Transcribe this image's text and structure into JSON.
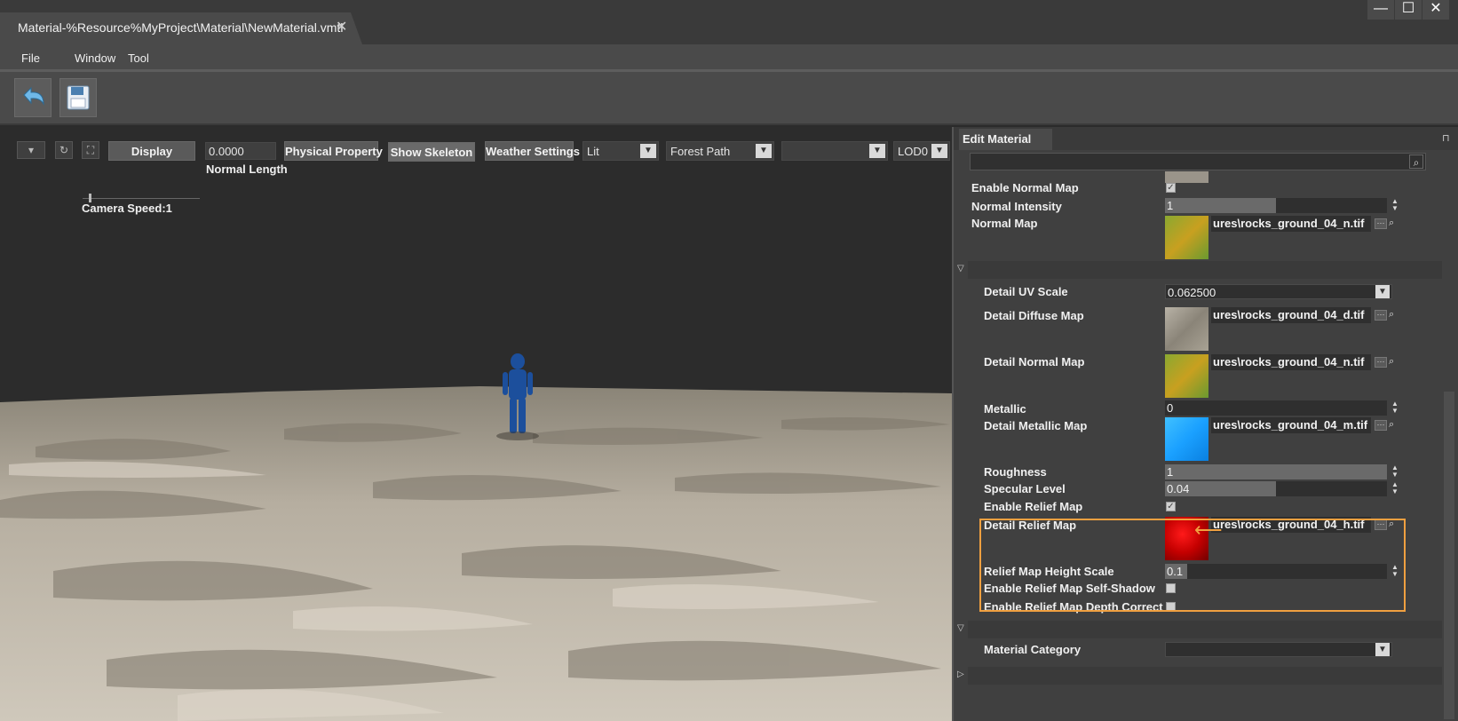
{
  "window": {
    "tab_title": "Material-%Resource%MyProject\\Material\\NewMaterial.vmtl",
    "controls": [
      "—",
      "☐",
      "✕"
    ]
  },
  "menu": [
    "File",
    "Window",
    "Tool"
  ],
  "viewport": {
    "display_label": "Display",
    "normal_length_value": "0.0000",
    "normal_length_label": "Normal Length",
    "physical_property_label": "Physical Property",
    "show_skeleton_label": "Show Skeleton",
    "weather_settings_label": "Weather Settings",
    "lighting_mode": "Lit",
    "environment": "Forest Path",
    "empty_select": "",
    "lod": "LOD0",
    "camera_speed_label": "Camera Speed:1"
  },
  "panel": {
    "title": "Edit Material",
    "search_placeholder": "",
    "enable_normal_map": "Enable Normal Map",
    "normal_intensity_label": "Normal Intensity",
    "normal_intensity_value": "1",
    "normal_map_label": "Normal Map",
    "normal_map_path": "ures\\rocks_ground_04_n.tif",
    "detail_uv_scale_label": "Detail UV Scale",
    "detail_uv_scale_value": "0.062500",
    "detail_diffuse_label": "Detail Diffuse Map",
    "detail_diffuse_path": "ures\\rocks_ground_04_d.tif",
    "detail_normal_label": "Detail Normal Map",
    "detail_normal_path": "ures\\rocks_ground_04_n.tif",
    "metallic_label": "Metallic",
    "metallic_value": "0",
    "detail_metallic_label": "Detail Metallic Map",
    "detail_metallic_path": "ures\\rocks_ground_04_m.tif",
    "roughness_label": "Roughness",
    "roughness_value": "1",
    "specular_label": "Specular Level",
    "specular_value": "0.04",
    "enable_relief_label": "Enable Relief Map",
    "detail_relief_label": "Detail Relief Map",
    "detail_relief_path": "ures\\rocks_ground_04_h.tif",
    "relief_height_label": "Relief Map Height Scale",
    "relief_height_value": "0.1",
    "relief_self_shadow_label": "Enable Relief Map Self-Shadow",
    "relief_depth_label": "Enable Relief Map Depth Correct",
    "material_category_label": "Material Category",
    "material_category_value": ""
  },
  "colors": {
    "highlight": "#f0a040",
    "metallic_thumb": "#1aa0ff",
    "relief_thumb": "#c40000"
  }
}
